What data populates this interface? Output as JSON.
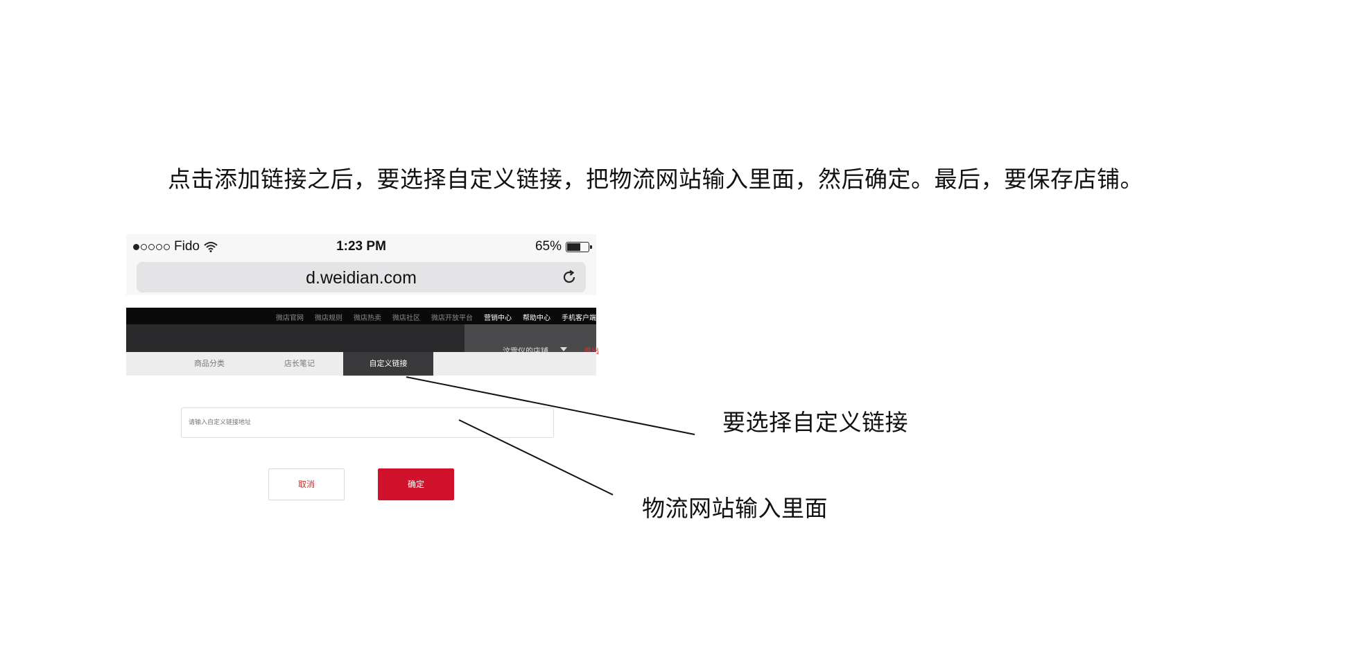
{
  "instruction": "点击添加链接之后，要选择自定义链接，把物流网站输入里面，然后确定。最后，要保存店铺。",
  "status_bar": {
    "carrier": "Fido",
    "time": "1:23 PM",
    "battery_percent_label": "65%",
    "battery_level": 0.65
  },
  "browser": {
    "url": "d.weidian.com"
  },
  "top_nav": {
    "links": [
      "微店官网",
      "微店规则",
      "微店热卖",
      "微店社区",
      "微店开放平台",
      "营销中心",
      "帮助中心",
      "手机客户端"
    ]
  },
  "shop": {
    "name": "汶雪仪的店铺",
    "logout": "退出"
  },
  "tabs": [
    "商品分类",
    "店长笔记",
    "自定义链接"
  ],
  "active_tab_index": 2,
  "link_input": {
    "placeholder": "请输入自定义链接地址"
  },
  "buttons": {
    "cancel": "取消",
    "confirm": "确定"
  },
  "callouts": {
    "select_custom_link": "要选择自定义链接",
    "enter_website": "物流网站输入里面"
  },
  "colors": {
    "accent": "#d0112b",
    "nav_bg": "#0a0a0a",
    "header_bg": "#2a2a2c",
    "active_tab_bg": "#3a3a3c"
  },
  "icons": [
    "wifi-icon",
    "battery-icon",
    "reload-icon",
    "caret-down-icon"
  ]
}
